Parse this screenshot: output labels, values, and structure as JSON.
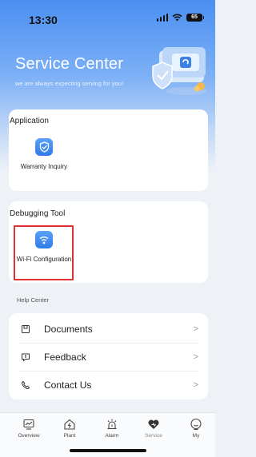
{
  "status_bar": {
    "time": "13:30",
    "battery": "65"
  },
  "header": {
    "title": "Service Center",
    "subtitle": "we are always expecting serving for you!"
  },
  "application": {
    "title": "Application",
    "items": [
      {
        "label": "Warranty Inquiry",
        "icon": "shield-icon"
      }
    ]
  },
  "debugging": {
    "title": "Debugging Tool",
    "items": [
      {
        "label": "Wi-Fi Configuration",
        "icon": "wifi-icon"
      }
    ]
  },
  "help_center": {
    "title": "Help Center",
    "items": [
      {
        "label": "Documents",
        "icon": "documents-icon"
      },
      {
        "label": "Feedback",
        "icon": "feedback-icon"
      },
      {
        "label": "Contact Us",
        "icon": "phone-icon"
      }
    ]
  },
  "tabbar": {
    "items": [
      {
        "label": "Overview",
        "icon": "overview-icon"
      },
      {
        "label": "Plant",
        "icon": "plant-icon"
      },
      {
        "label": "Alarm",
        "icon": "alarm-icon"
      },
      {
        "label": "Service",
        "icon": "service-icon",
        "active": true
      },
      {
        "label": "My",
        "icon": "user-icon"
      }
    ]
  },
  "colors": {
    "accent": "#3b82f6",
    "highlight": "#e03030",
    "background": "#eef2f7"
  }
}
